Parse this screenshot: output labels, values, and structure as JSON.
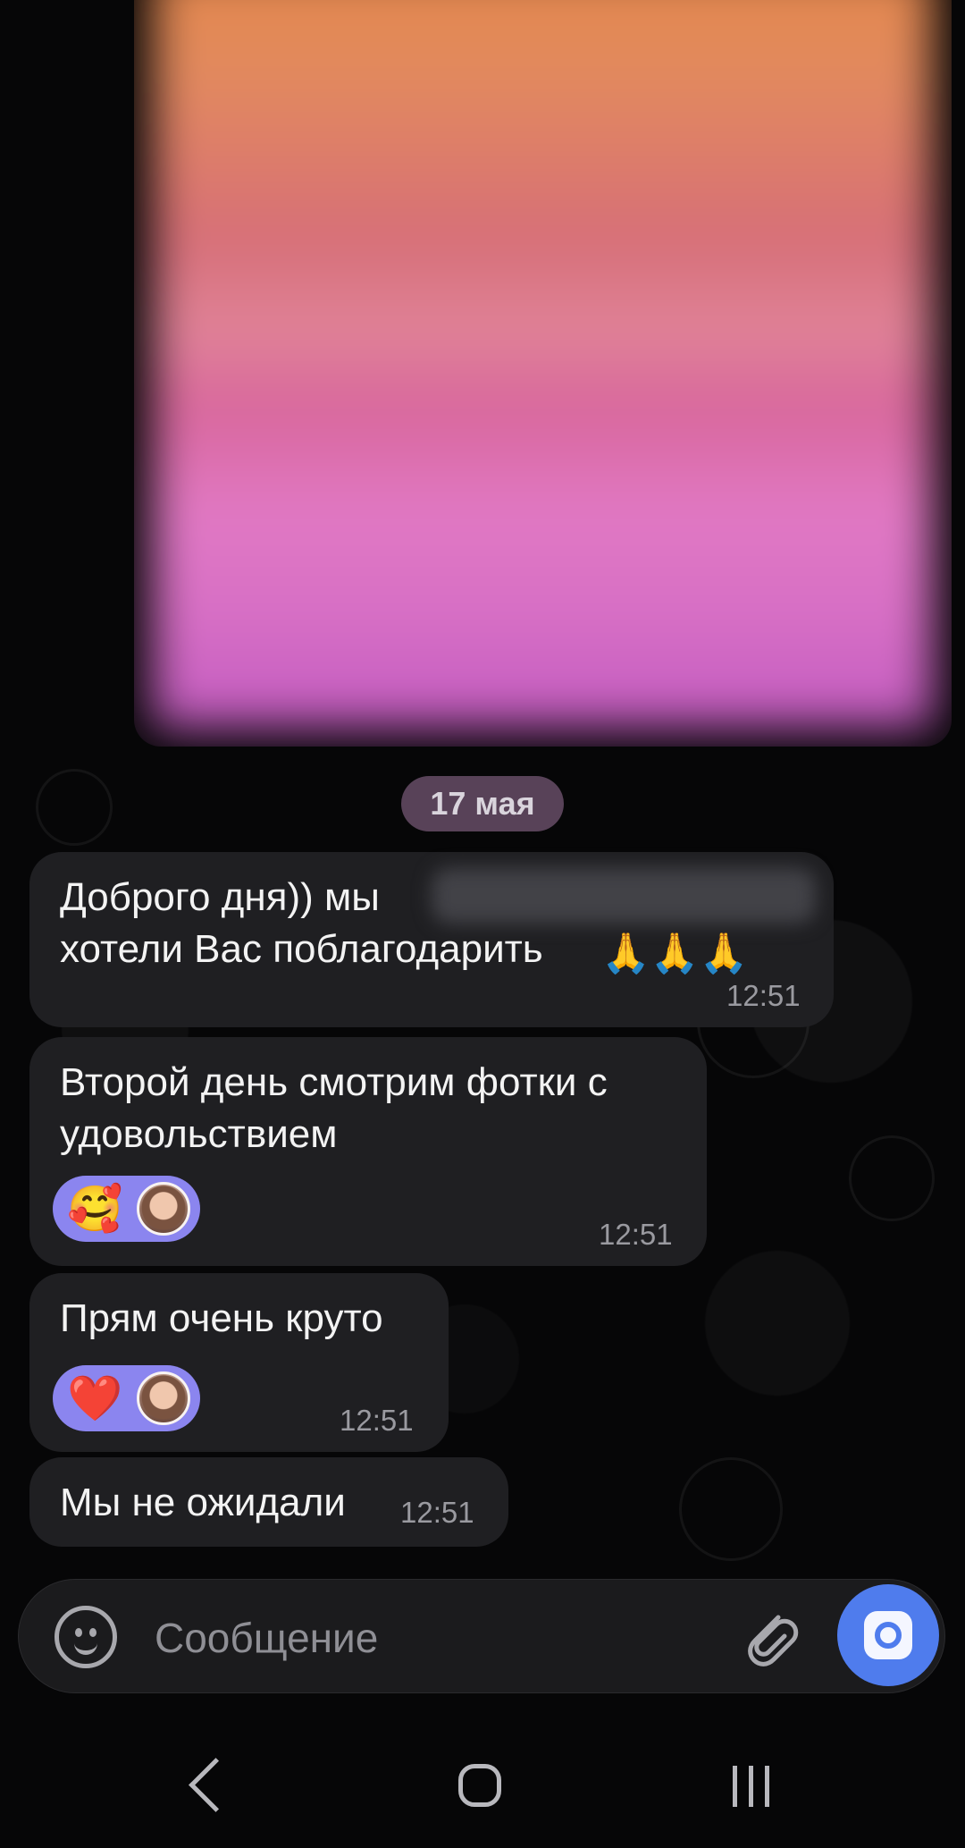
{
  "date_separator": "17 мая",
  "messages": [
    {
      "text_line_1": "Доброго дня)) мы",
      "text_line_2": "хотели Вас поблагодарить",
      "emoji": "🙏🙏🙏",
      "time": "12:51"
    },
    {
      "text": "Второй день смотрим фотки с\nудовольствием",
      "reaction_emoji": "🥰",
      "time": "12:51"
    },
    {
      "text": "Прям очень круто",
      "reaction_emoji": "❤️",
      "time": "12:51"
    },
    {
      "text": "Мы не ожидали",
      "time": "12:51"
    }
  ],
  "composer": {
    "placeholder": "Сообщение",
    "smile_icon": "smile-icon",
    "attach_icon": "paperclip-icon",
    "camera_icon": "camera-icon"
  },
  "colors": {
    "accent": "#4f7ced",
    "reaction": "#8b85ef",
    "bubble": "#1f1f22"
  }
}
